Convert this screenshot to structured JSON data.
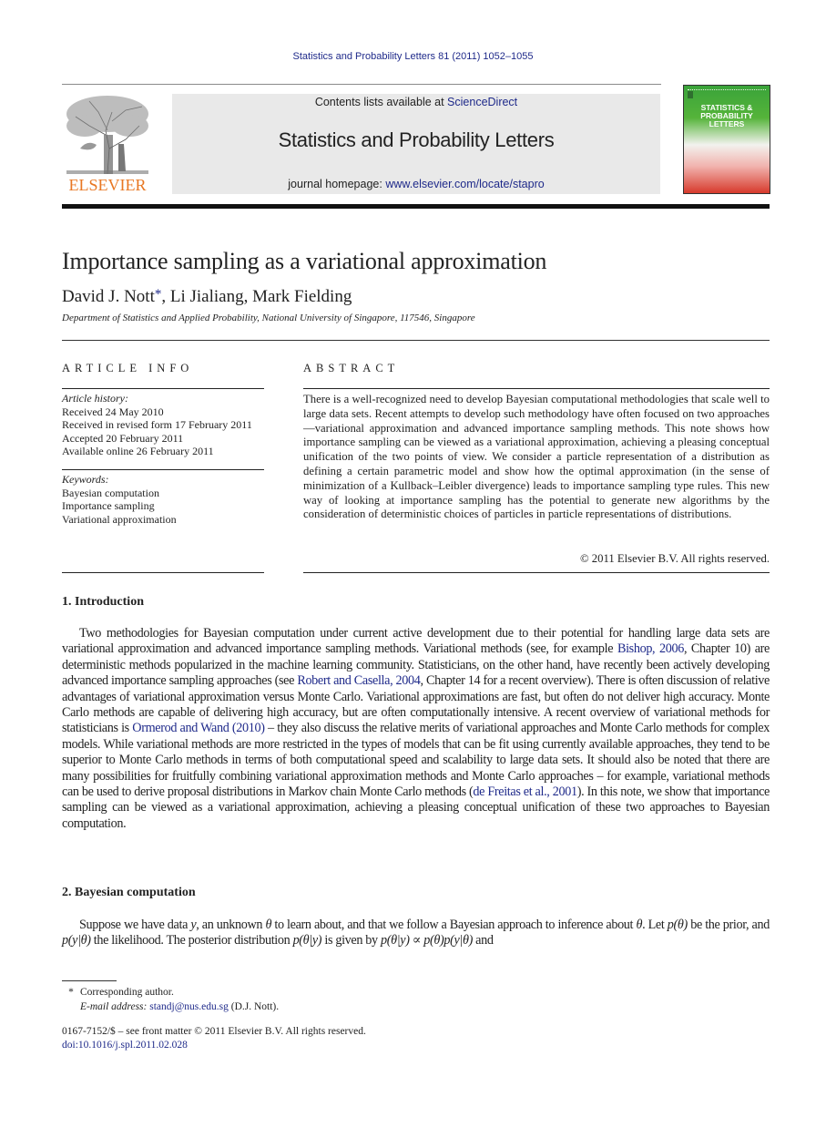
{
  "running_head": "Statistics and Probability Letters 81 (2011) 1052–1055",
  "masthead": {
    "publisher_logo_text": "ELSEVIER",
    "contents_prefix": "Contents lists available at ",
    "contents_link": "ScienceDirect",
    "journal_title": "Statistics and Probability Letters",
    "homepage_prefix": "journal homepage: ",
    "homepage_link": "www.elsevier.com/locate/stapro",
    "cover_title_lines": [
      "STATISTICS &",
      "PROBABILITY",
      "LETTERS"
    ]
  },
  "article": {
    "title": "Importance sampling as a variational approximation",
    "authors": [
      {
        "name": "David J. Nott",
        "mark": "*"
      },
      {
        "name": "Li Jialiang"
      },
      {
        "name": "Mark Fielding"
      }
    ],
    "author_sep": ", ",
    "affiliation": "Department of Statistics and Applied Probability, National University of Singapore, 117546, Singapore"
  },
  "article_info": {
    "heading": "ARTICLE INFO",
    "history_label": "Article history:",
    "history": [
      "Received 24 May 2010",
      "Received in revised form 17 February 2011",
      "Accepted 20 February 2011",
      "Available online 26 February 2011"
    ],
    "keywords_label": "Keywords:",
    "keywords": [
      "Bayesian computation",
      "Importance sampling",
      "Variational approximation"
    ]
  },
  "abstract": {
    "heading": "ABSTRACT",
    "text": "There is a well-recognized need to develop Bayesian computational methodologies that scale well to large data sets. Recent attempts to develop such methodology have often focused on two approaches—variational approximation and advanced importance sampling methods. This note shows how importance sampling can be viewed as a variational approximation, achieving a pleasing conceptual unification of the two points of view. We consider a particle representation of a distribution as defining a certain parametric model and show how the optimal approximation (in the sense of minimization of a Kullback–Leibler divergence) leads to importance sampling type rules. This new way of looking at importance sampling has the potential to generate new algorithms by the consideration of deterministic choices of particles in particle representations of distributions.",
    "copyright": "© 2011 Elsevier B.V. All rights reserved."
  },
  "sections": [
    {
      "title": "1.  Introduction",
      "paragraph": [
        {
          "t": "Two methodologies for Bayesian computation under current active development due to their potential for handling large data sets are variational approximation and advanced importance sampling methods. Variational methods (see, for example "
        },
        {
          "link": "Bishop, 2006"
        },
        {
          "t": ", Chapter 10) are deterministic methods popularized in the machine learning community. Statisticians, on the other hand, have recently been actively developing advanced importance sampling approaches (see "
        },
        {
          "link": "Robert and Casella, 2004"
        },
        {
          "t": ", Chapter 14 for a recent overview). There is often discussion of relative advantages of variational approximation versus Monte Carlo. Variational approximations are fast, but often do not deliver high accuracy. Monte Carlo methods are capable of delivering high accuracy, but are often computationally intensive. A recent overview of variational methods for statisticians is "
        },
        {
          "link": "Ormerod and Wand (2010)"
        },
        {
          "t": " – they also discuss the relative merits of variational approaches and Monte Carlo methods for complex models. While variational methods are more restricted in the types of models that can be fit using currently available approaches, they tend to be superior to Monte Carlo methods in terms of both computational speed and scalability to large data sets. It should also be noted that there are many possibilities for fruitfully combining variational approximation methods and Monte Carlo approaches – for example, variational methods can be used to derive proposal distributions in Markov chain Monte Carlo methods ("
        },
        {
          "link": "de Freitas et al., 2001"
        },
        {
          "t": "). In this note, we show that importance sampling can be viewed as a variational approximation, achieving a pleasing conceptual unification of these two approaches to Bayesian computation."
        }
      ]
    },
    {
      "title": "2.  Bayesian computation",
      "paragraph": [
        {
          "t": "Suppose we have data "
        },
        {
          "m": "y"
        },
        {
          "t": ", an unknown "
        },
        {
          "m": "θ"
        },
        {
          "t": " to learn about, and that we follow a Bayesian approach to inference about "
        },
        {
          "m": "θ"
        },
        {
          "t": ". Let "
        },
        {
          "m": "p(θ)"
        },
        {
          "t": " be the prior, and "
        },
        {
          "m": "p(y|θ)"
        },
        {
          "t": " the likelihood. The posterior distribution "
        },
        {
          "m": "p(θ|y)"
        },
        {
          "t": " is given by "
        },
        {
          "m": "p(θ|y)"
        },
        {
          "t": "  ∝  "
        },
        {
          "m": "p(θ)p(y|θ)"
        },
        {
          "t": " and"
        }
      ]
    }
  ],
  "footnotes": {
    "star": "*",
    "corresponding": "Corresponding author.",
    "email_label": "E-mail address:",
    "email": "standj@nus.edu.sg",
    "email_suffix": " (D.J. Nott)."
  },
  "front_matter": {
    "issn_line": "0167-7152/$ – see front matter © 2011 Elsevier B.V. All rights reserved.",
    "doi": "doi:10.1016/j.spl.2011.02.028"
  }
}
